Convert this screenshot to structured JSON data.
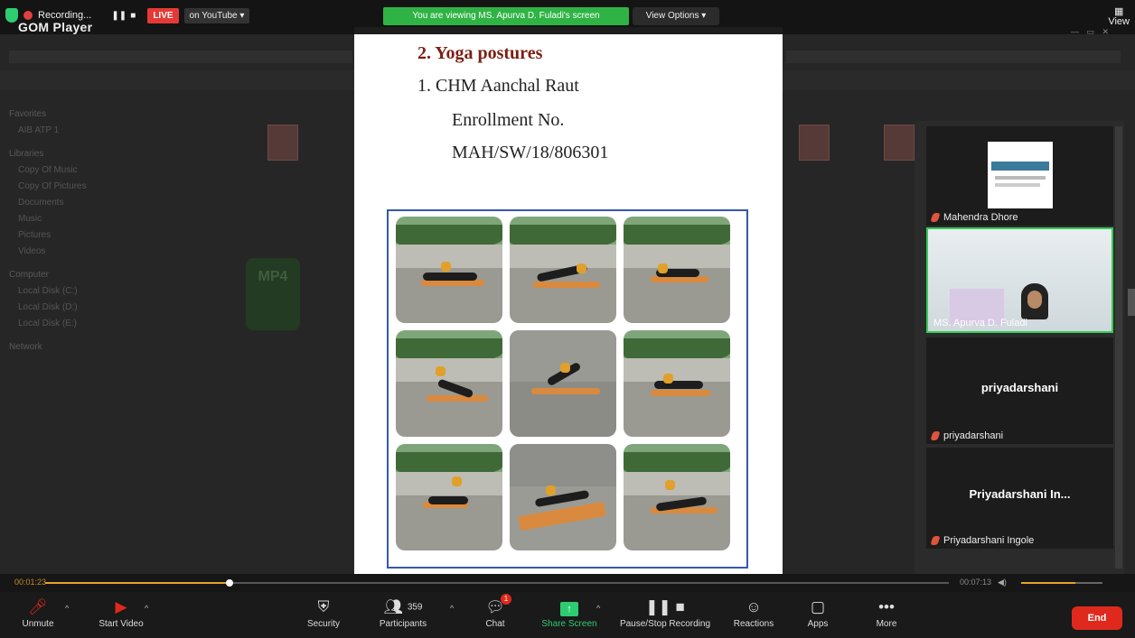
{
  "topbar": {
    "recording_label": "Recording...",
    "live_label": "LIVE",
    "stream_target": "on YouTube ▾",
    "app_name": "GOM Player",
    "viewing_banner": "You are viewing MS. Apurva D. Fuladi's screen",
    "view_options_label": "View Options ▾",
    "view_label": "View"
  },
  "explorer": {
    "sidebar": [
      "Favorites",
      "AIB ATP 1",
      "Libraries",
      "Copy Of Music",
      "Copy Of Pictures",
      "Documents",
      "Music",
      "Pictures",
      "Videos",
      "Computer",
      "Local Disk (C:)",
      "Local Disk (D:)",
      "Local Disk (E:)",
      "Network"
    ],
    "mp4_label": "MP4"
  },
  "document": {
    "heading": "2.  Yoga postures",
    "line1": "1.   CHM Aanchal Raut",
    "line2": "Enrollment No.",
    "line3": "MAH/SW/18/806301"
  },
  "participants": [
    {
      "name": "Mahendra Dhore"
    },
    {
      "name": "MS. Apurva D. Fuladi"
    },
    {
      "name": "priyadarshani",
      "display": "priyadarshani"
    },
    {
      "name": "Priyadarshani Ingole",
      "display": "Priyadarshani  In..."
    }
  ],
  "player": {
    "elapsed": "00:01:23",
    "total": "00:07:13"
  },
  "toolbar": {
    "unmute": "Unmute",
    "start_video": "Start Video",
    "security": "Security",
    "participants": "Participants",
    "participant_count": "359",
    "chat": "Chat",
    "chat_badge": "1",
    "share_screen": "Share Screen",
    "pause_recording": "Pause/Stop Recording",
    "reactions": "Reactions",
    "apps": "Apps",
    "more": "More",
    "end": "End"
  },
  "colors": {
    "live": "#e53935",
    "banner": "#2fb344",
    "end": "#e0291d",
    "heading": "#7a1f14",
    "frame": "#3659a8"
  }
}
